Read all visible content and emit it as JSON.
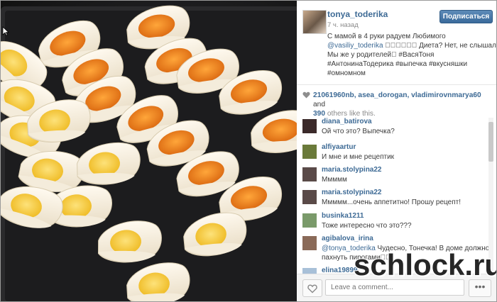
{
  "post": {
    "username": "tonya_toderika",
    "time": "7 ч. назад",
    "follow_label": "Подписаться",
    "caption": {
      "line1": "С мамой в 4 руки радуем Любимого",
      "line2_mention": "@vasiliy_toderika",
      "line2_rest": " 󾌸󾌸󾌸󾌸󾌸󾌸 Диета? Нет, не слышали󾌸",
      "line3": "Мы же у родителей󾌸 #ВасяТоня",
      "line4": "#АнтонинаТодерика #выпечка #вкусняшки",
      "line5": "#омномном"
    },
    "likes": {
      "users": "21061960nb, asea_dorogan, vladimirovnmarya60",
      "and": " and",
      "others": "390",
      "others_suffix": " others like this."
    }
  },
  "comments": [
    {
      "user": "diana_batirova",
      "text": "Ой что это? Выпечка?",
      "avatar_color": "#3b2a2a"
    },
    {
      "user": "alfiyaartur",
      "text": "И мне и мне рецептик",
      "avatar_color": "#6a7a3a"
    },
    {
      "user": "maria.stolypina22",
      "text": "Ммммм",
      "avatar_color": "#5a4a48"
    },
    {
      "user": "maria.stolypina22",
      "text": "Ммммм...очень аппетитно! Прошу рецепт!",
      "avatar_color": "#5a4a48"
    },
    {
      "user": "businka1211",
      "text": "Тоже интересно что это???",
      "avatar_color": "#7a9a6a"
    },
    {
      "user": "agibalova_irina",
      "mention": "@tonya_toderika",
      "text": " Чудесно, Тонечка! В доме должно",
      "text2": "пахнуть пирогами󾌸󾌸",
      "avatar_color": "#8a6a58"
    },
    {
      "user": "elina19899",
      "text": "",
      "avatar_color": "#a8c0d8"
    }
  ],
  "footer": {
    "comment_placeholder": "Leave a comment...",
    "more_label": "•••"
  },
  "watermark": "schlock.ru",
  "colors": {
    "link": "#3d6a95",
    "follow_button": "#3a6a9b",
    "carrot": "#f08a1c",
    "egg_filling": "#f5cc2a",
    "pastry": "#f6efe0",
    "tray": "#222224"
  },
  "icons": {
    "like_count": "heart-icon",
    "like_button": "heart-outline-icon",
    "more": "ellipsis-icon",
    "cursor": "arrow-cursor-icon"
  }
}
